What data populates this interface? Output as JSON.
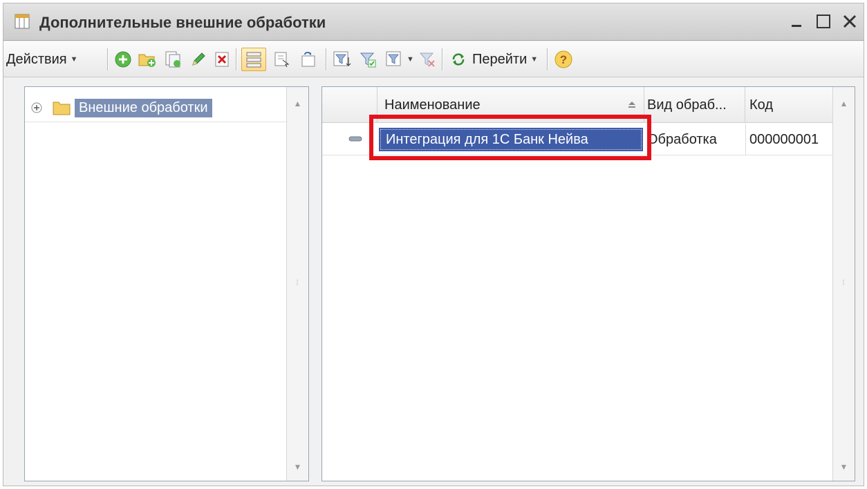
{
  "window": {
    "title": "Дополнительные внешние обработки"
  },
  "toolbar": {
    "actions_label": "Действия",
    "goto_label": "Перейти",
    "help_glyph": "?",
    "icons": [
      "add-icon",
      "add-folder-icon",
      "copy-icon",
      "edit-icon",
      "delete-icon",
      "hierarchy-icon",
      "move-to-group-icon",
      "refresh-list-icon",
      "filter-icon",
      "filter-by-value-icon",
      "filter-history-icon",
      "clear-filter-icon",
      "goto-icon",
      "help-icon"
    ]
  },
  "tree": {
    "root_label": "Внешние обработки"
  },
  "table": {
    "columns": [
      "Наименование",
      "Вид обраб...",
      "Код"
    ],
    "rows": [
      {
        "name": "Интеграция для 1С Банк Нейва",
        "kind": "Обработка",
        "code": "000000001"
      }
    ]
  },
  "colors": {
    "selection": "#3f5ca8",
    "tree_selection": "#7b8fb5",
    "highlight": "#e3131b"
  }
}
